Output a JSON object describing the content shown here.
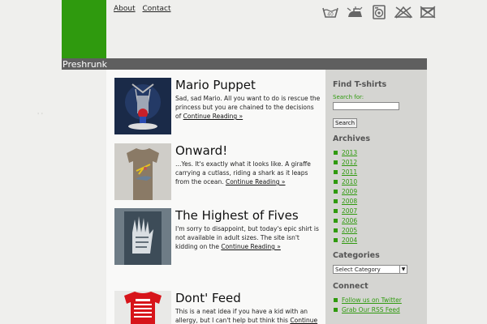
{
  "site": {
    "title": "Preshrunk",
    "green": "#2f9a0e"
  },
  "nav": {
    "about": "About",
    "contact": "Contact"
  },
  "laundry_icons": [
    "wash-icon",
    "iron-icon",
    "dryer-icon",
    "no-bleach-icon",
    "no-dryclean-icon"
  ],
  "posts": [
    {
      "title": "Mario Puppet",
      "excerpt": "Sad, sad Mario. All you want to do is rescue the princess but you are chained to the decisions of",
      "link": "Continue Reading »"
    },
    {
      "title": "Onward!",
      "excerpt": "…Yes. It's exactly what it looks like. A giraffe carrying a cutlass, riding a shark as it leaps from the ocean.",
      "link": "Continue Reading »"
    },
    {
      "title": "The Highest of Fives",
      "excerpt": "I'm sorry to disappoint, but today's epic shirt is not available in adult sizes. The site isn't kidding on the",
      "link": "Continue Reading »"
    },
    {
      "title": "Dont' Feed",
      "excerpt": "This is a neat idea if you have a kid with an allergy, but I can't help but think this",
      "link": "Continue Reading »"
    }
  ],
  "sidebar": {
    "find_heading": "Find T-shirts",
    "search_label": "Search for:",
    "search_button": "Search",
    "archives_heading": "Archives",
    "archives": [
      "2013",
      "2012",
      "2011",
      "2010",
      "2009",
      "2008",
      "2007",
      "2006",
      "2005",
      "2004"
    ],
    "categories_heading": "Categories",
    "category_select": "Select Category",
    "connect_heading": "Connect",
    "connect": [
      "Follow us on Twitter",
      "Grab Our RSS Feed"
    ]
  }
}
